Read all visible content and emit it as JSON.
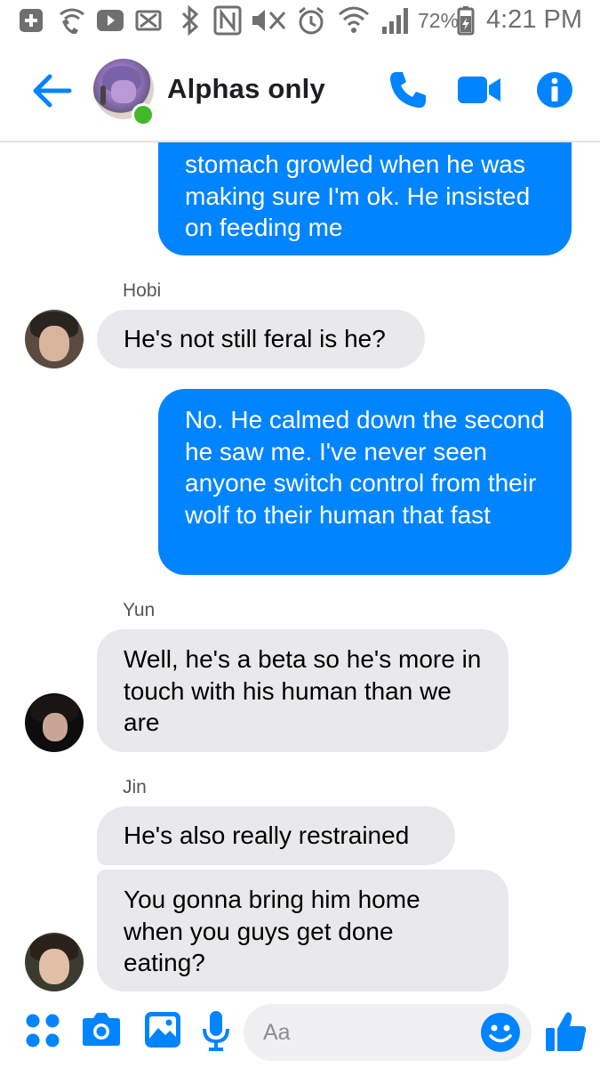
{
  "status_bar": {
    "battery_percent": "72%",
    "time": "4:21 PM",
    "icons": [
      "add-icon",
      "wifi-calling-icon",
      "youtube-icon",
      "sim-off-icon",
      "bluetooth-icon",
      "nfc-icon",
      "mute-icon",
      "alarm-icon",
      "wifi-icon",
      "signal-icon",
      "battery-charging-icon"
    ]
  },
  "header": {
    "title": "Alphas only",
    "online": true,
    "icons": [
      "back-arrow-icon",
      "phone-icon",
      "video-camera-icon",
      "info-icon"
    ]
  },
  "colors": {
    "accent": "#0084ff",
    "outgoing_bubble": "#0084ff",
    "incoming_bubble": "#e9e9eb",
    "online": "#42b72a"
  },
  "messages": [
    {
      "from": "me",
      "text": "stomach growled when he was making sure I'm ok. He insisted on feeding me"
    },
    {
      "from": "Hobi",
      "sender_label": "Hobi",
      "text": "He's not still feral is he?"
    },
    {
      "from": "me",
      "text": "No. He calmed down the second he saw me. I've never seen anyone switch control from their wolf to their human that fast"
    },
    {
      "from": "Yun",
      "sender_label": "Yun",
      "text": "Well, he's a beta so he's more in touch with his human than we are"
    },
    {
      "from": "Jin",
      "sender_label": "Jin",
      "text": "He's also really restrained"
    },
    {
      "from": "Jin",
      "text": "You gonna bring him home when you guys get done eating?"
    }
  ],
  "composer": {
    "placeholder": "Aa",
    "icons": [
      "apps-icon",
      "camera-icon",
      "gallery-icon",
      "microphone-icon",
      "emoji-icon",
      "thumbs-up-icon"
    ]
  }
}
